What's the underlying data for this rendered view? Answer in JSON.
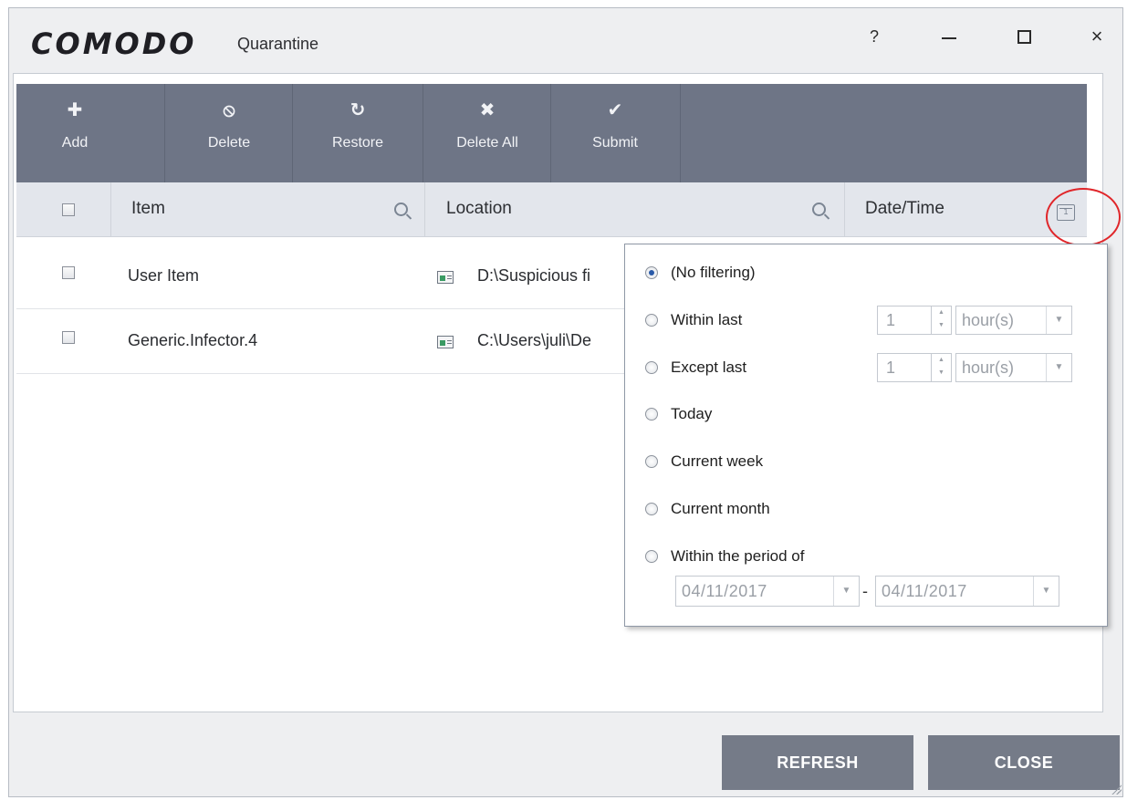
{
  "window": {
    "logo": "COMODO",
    "title": "Quarantine",
    "controls": {
      "help": "?",
      "minimize": "minimize",
      "maximize": "maximize",
      "close": "×"
    }
  },
  "toolbar": {
    "items": [
      {
        "label": "Add",
        "icon": "plus-icon",
        "glyph": "✚"
      },
      {
        "label": "Delete",
        "icon": "ban-icon",
        "glyph": "⦸"
      },
      {
        "label": "Restore",
        "icon": "restore-icon",
        "glyph": "↻"
      },
      {
        "label": "Delete All",
        "icon": "x-icon",
        "glyph": "✖"
      },
      {
        "label": "Submit",
        "icon": "check-icon",
        "glyph": "✔"
      }
    ]
  },
  "table": {
    "columns": [
      "Item",
      "Location",
      "Date/Time"
    ],
    "rows": [
      {
        "item": "User Item",
        "location": "D:\\Suspicious fi"
      },
      {
        "item": "Generic.Infector.4",
        "location": "C:\\Users\\juli\\De"
      }
    ]
  },
  "filter_popup": {
    "options": [
      {
        "label": "(No filtering)",
        "selected": true
      },
      {
        "label": "Within last",
        "selected": false
      },
      {
        "label": "Except last",
        "selected": false
      },
      {
        "label": "Today",
        "selected": false
      },
      {
        "label": "Current week",
        "selected": false
      },
      {
        "label": "Current month",
        "selected": false
      },
      {
        "label": "Within the period of",
        "selected": false
      }
    ],
    "within_last": {
      "value": "1",
      "unit": "hour(s)"
    },
    "except_last": {
      "value": "1",
      "unit": "hour(s)"
    },
    "period": {
      "from": "04/11/2017",
      "to": "04/11/2017",
      "separator": "-"
    }
  },
  "buttons": {
    "refresh": "REFRESH",
    "close": "CLOSE"
  },
  "colors": {
    "toolbar": "#6e7586",
    "buttons": "#757b88",
    "highlight": "#e0262a",
    "radio_selected": "#2a5aa8"
  }
}
